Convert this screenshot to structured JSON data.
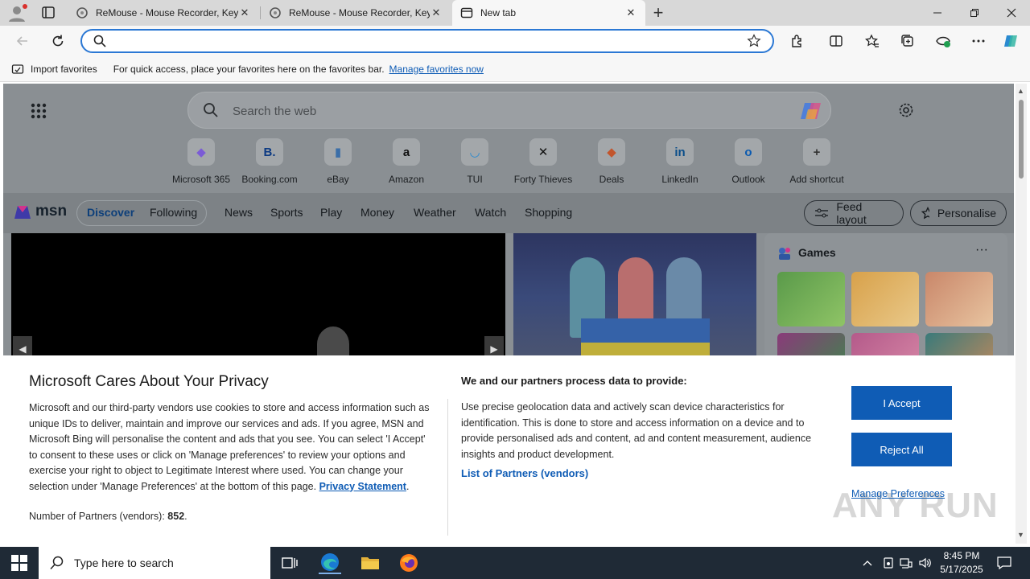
{
  "browser": {
    "tabs": [
      {
        "title": "ReMouse - Mouse Recorder, Keyb"
      },
      {
        "title": "ReMouse - Mouse Recorder, Keyb"
      },
      {
        "title": "New tab"
      }
    ],
    "address": {
      "value": "",
      "placeholder": ""
    }
  },
  "favorites_bar": {
    "import_label": "Import favorites",
    "message": "For quick access, place your favorites here on the favorites bar.",
    "manage_link": "Manage favorites now"
  },
  "newtab": {
    "search_placeholder": "Search the web",
    "shortcuts": [
      {
        "label": "Microsoft 365",
        "glyph": "◆",
        "color": "#7b5bd6"
      },
      {
        "label": "Booking.com",
        "glyph": "B.",
        "color": "#0c3a82"
      },
      {
        "label": "eBay",
        "glyph": "▮",
        "color": "#3b6ea8"
      },
      {
        "label": "Amazon",
        "glyph": "a",
        "color": "#111111"
      },
      {
        "label": "TUI",
        "glyph": "◡",
        "color": "#2a8ad0"
      },
      {
        "label": "Forty Thieves",
        "glyph": "✕",
        "color": "#111111"
      },
      {
        "label": "Deals",
        "glyph": "◆",
        "color": "#c2552c"
      },
      {
        "label": "LinkedIn",
        "glyph": "in",
        "color": "#0a4e8a"
      },
      {
        "label": "Outlook",
        "glyph": "o",
        "color": "#0a5ab0"
      },
      {
        "label": "Add shortcut",
        "glyph": "+",
        "color": "#333333"
      }
    ]
  },
  "msn": {
    "logo": "msn",
    "tabs": [
      "Discover",
      "Following"
    ],
    "nav": [
      "News",
      "Sports",
      "Play",
      "Money",
      "Weather",
      "Watch",
      "Shopping"
    ],
    "feed_layout": "Feed layout",
    "personalise": "Personalise",
    "games_title": "Games"
  },
  "privacy": {
    "title": "Microsoft Cares About Your Privacy",
    "body": "Microsoft and our third-party vendors use cookies to store and access information such as unique IDs to deliver, maintain and improve our services and ads. If you agree, MSN and Microsoft Bing will personalise the content and ads that you see. You can select 'I Accept' to consent to these uses or click on 'Manage preferences' to review your options and exercise your right to object to Legitimate Interest where used.  You can change your selection under 'Manage Preferences' at the bottom of this page.",
    "privacy_link": "Privacy Statement",
    "partners_label": "Number of Partners (vendors):",
    "partners_count": "852",
    "right_title": "We and our partners process data to provide:",
    "right_body": "Use precise geolocation data and actively scan device characteristics for identification. This is done to store and access information on a device and to provide personalised ads and content, ad and content measurement, audience insights and product development.",
    "partners_list_link": "List of Partners (vendors)",
    "accept_label": "I Accept",
    "reject_label": "Reject All",
    "manage_label": "Manage Preferences",
    "watermark": "ANY RUN"
  },
  "taskbar": {
    "search_placeholder": "Type here to search",
    "time": "8:45 PM",
    "date": "5/17/2025"
  }
}
